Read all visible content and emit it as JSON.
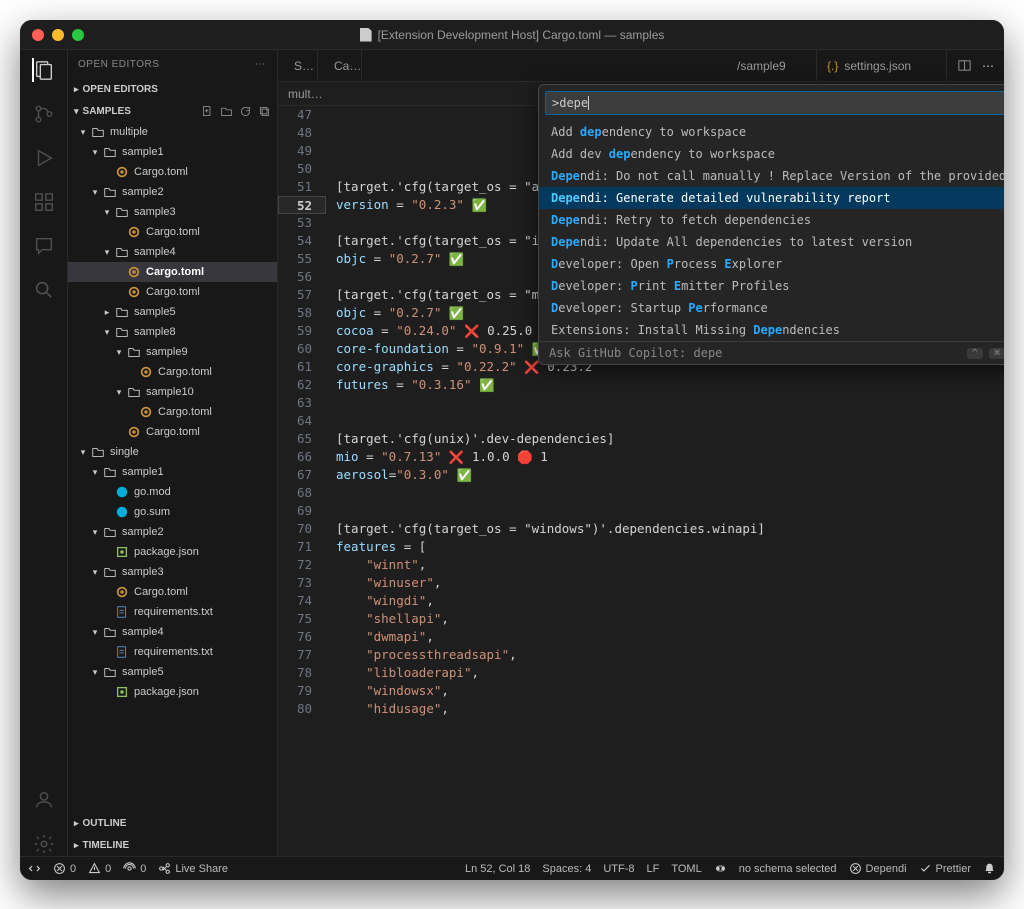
{
  "window": {
    "title": "[Extension Development Host] Cargo.toml — samples"
  },
  "sidebar": {
    "header": "OPEN EDITORS",
    "sections": {
      "openEditors": "OPEN EDITORS",
      "samples": "SAMPLES",
      "outline": "OUTLINE",
      "timeline": "TIMELINE"
    },
    "tree": [
      {
        "depth": 0,
        "type": "folder",
        "open": true,
        "label": "multiple"
      },
      {
        "depth": 1,
        "type": "folder",
        "open": true,
        "label": "sample1"
      },
      {
        "depth": 2,
        "type": "cargo",
        "label": "Cargo.toml"
      },
      {
        "depth": 1,
        "type": "folder",
        "open": true,
        "label": "sample2"
      },
      {
        "depth": 2,
        "type": "folder",
        "open": true,
        "label": "sample3"
      },
      {
        "depth": 3,
        "type": "cargo",
        "label": "Cargo.toml"
      },
      {
        "depth": 2,
        "type": "folder",
        "open": true,
        "label": "sample4"
      },
      {
        "depth": 3,
        "type": "cargo",
        "label": "Cargo.toml",
        "selected": true
      },
      {
        "depth": 3,
        "type": "cargo",
        "label": "Cargo.toml"
      },
      {
        "depth": 2,
        "type": "folder",
        "open": false,
        "label": "sample5"
      },
      {
        "depth": 2,
        "type": "folder",
        "open": true,
        "label": "sample8"
      },
      {
        "depth": 3,
        "type": "folder",
        "open": true,
        "label": "sample9"
      },
      {
        "depth": 4,
        "type": "cargo",
        "label": "Cargo.toml"
      },
      {
        "depth": 3,
        "type": "folder",
        "open": true,
        "label": "sample10"
      },
      {
        "depth": 4,
        "type": "cargo",
        "label": "Cargo.toml"
      },
      {
        "depth": 3,
        "type": "cargo",
        "label": "Cargo.toml"
      },
      {
        "depth": 0,
        "type": "folder",
        "open": true,
        "label": "single"
      },
      {
        "depth": 1,
        "type": "folder",
        "open": true,
        "label": "sample1"
      },
      {
        "depth": 2,
        "type": "go",
        "label": "go.mod"
      },
      {
        "depth": 2,
        "type": "go",
        "label": "go.sum"
      },
      {
        "depth": 1,
        "type": "folder",
        "open": true,
        "label": "sample2"
      },
      {
        "depth": 2,
        "type": "npm",
        "label": "package.json"
      },
      {
        "depth": 1,
        "type": "folder",
        "open": true,
        "label": "sample3"
      },
      {
        "depth": 2,
        "type": "cargo",
        "label": "Cargo.toml"
      },
      {
        "depth": 2,
        "type": "py",
        "label": "requirements.txt"
      },
      {
        "depth": 1,
        "type": "folder",
        "open": true,
        "label": "sample4"
      },
      {
        "depth": 2,
        "type": "py",
        "label": "requirements.txt"
      },
      {
        "depth": 1,
        "type": "folder",
        "open": true,
        "label": "sample5"
      },
      {
        "depth": 2,
        "type": "npm",
        "label": "package.json"
      }
    ]
  },
  "tabs": {
    "left_trunc": "S…",
    "left2_trunc": "Ca…",
    "right1": "/sample9",
    "right2": "settings.json"
  },
  "breadcrumb": {
    "text": "mult…"
  },
  "palette": {
    "input": ">depe",
    "items": [
      {
        "pre": "Add ",
        "hl": "dep",
        "post": "endency to workspace"
      },
      {
        "pre": "Add dev ",
        "hl": "dep",
        "post": "endency to workspace"
      },
      {
        "pre": "",
        "hl": "Depe",
        "post": "ndi: Do not call manually ! Replace Version of the provided dependen…"
      },
      {
        "pre": "",
        "hl": "Depe",
        "post": "ndi: Generate detailed vulnerability report",
        "selected": true,
        "gear": true
      },
      {
        "pre": "",
        "hl": "Depe",
        "post": "ndi: Retry to fetch dependencies"
      },
      {
        "pre": "",
        "hl": "Depe",
        "post": "ndi: Update All dependencies to latest version"
      },
      {
        "pre": "",
        "hl": "D",
        "post": "eveloper: Open ",
        "hl2": "P",
        "post2": "rocess ",
        "hl3": "E",
        "post3": "xplorer"
      },
      {
        "pre": "",
        "hl": "D",
        "post": "eveloper: ",
        "hl2": "P",
        "post2": "rint ",
        "hl3": "E",
        "post3": "mitter Profiles"
      },
      {
        "pre": "",
        "hl": "D",
        "post": "eveloper: Startup ",
        "hl2": "Pe",
        "post2": "rformance"
      },
      {
        "pre": "Extensions: Install Missing ",
        "hl": "Depe",
        "post": "ndencies"
      }
    ],
    "footer": "Ask GitHub Copilot: depe"
  },
  "code": {
    "lines": [
      {
        "n": 47,
        "t": ""
      },
      {
        "n": 48,
        "t": ""
      },
      {
        "n": 49,
        "t": ""
      },
      {
        "n": 50,
        "t": ""
      },
      {
        "n": 51,
        "parts": [
          {
            "c": "sec",
            "t": "[target.'cfg(target_os = \"android\")'.dependencies.android_glue]"
          }
        ]
      },
      {
        "n": 52,
        "current": true,
        "parts": [
          {
            "c": "key",
            "t": "version"
          },
          {
            "c": "op",
            "t": " = "
          },
          {
            "c": "str",
            "t": "\"0.2.3\""
          },
          {
            "c": "op",
            "t": " "
          },
          {
            "emoji": "check"
          }
        ]
      },
      {
        "n": 53,
        "t": ""
      },
      {
        "n": 54,
        "parts": [
          {
            "c": "sec",
            "t": "[target.'cfg(target_os = \"ios\")'.dependencies]"
          }
        ]
      },
      {
        "n": 55,
        "parts": [
          {
            "c": "key",
            "t": "objc"
          },
          {
            "c": "op",
            "t": " = "
          },
          {
            "c": "str",
            "t": "\"0.2.7\""
          },
          {
            "c": "op",
            "t": " "
          },
          {
            "emoji": "check"
          }
        ]
      },
      {
        "n": 56,
        "t": ""
      },
      {
        "n": 57,
        "parts": [
          {
            "c": "sec",
            "t": "[target.'cfg(target_os = \"macos\")'.dependencies]"
          }
        ]
      },
      {
        "n": 58,
        "parts": [
          {
            "c": "key",
            "t": "objc"
          },
          {
            "c": "op",
            "t": " = "
          },
          {
            "c": "str",
            "t": "\"0.2.7\""
          },
          {
            "c": "op",
            "t": " "
          },
          {
            "emoji": "check"
          }
        ]
      },
      {
        "n": 59,
        "parts": [
          {
            "c": "key",
            "t": "cocoa"
          },
          {
            "c": "op",
            "t": " = "
          },
          {
            "c": "str",
            "t": "\"0.24.0\""
          },
          {
            "c": "op",
            "t": " "
          },
          {
            "emoji": "cross"
          },
          {
            "c": "op",
            "t": " 0.25.0"
          }
        ]
      },
      {
        "n": 60,
        "parts": [
          {
            "c": "key",
            "t": "core-foundation"
          },
          {
            "c": "op",
            "t": " = "
          },
          {
            "c": "str",
            "t": "\"0.9.1\""
          },
          {
            "c": "op",
            "t": " "
          },
          {
            "emoji": "check"
          }
        ]
      },
      {
        "n": 61,
        "parts": [
          {
            "c": "key",
            "t": "core-graphics"
          },
          {
            "c": "op",
            "t": " = "
          },
          {
            "c": "str",
            "t": "\"0.22.2\""
          },
          {
            "c": "op",
            "t": " "
          },
          {
            "emoji": "cross"
          },
          {
            "c": "op",
            "t": " 0.23.2"
          }
        ]
      },
      {
        "n": 62,
        "parts": [
          {
            "c": "key",
            "t": "futures"
          },
          {
            "c": "op",
            "t": " = "
          },
          {
            "c": "str",
            "t": "\"0.3.16\""
          },
          {
            "c": "op",
            "t": " "
          },
          {
            "emoji": "check"
          }
        ]
      },
      {
        "n": 63,
        "t": ""
      },
      {
        "n": 64,
        "t": ""
      },
      {
        "n": 65,
        "parts": [
          {
            "c": "sec",
            "t": "[target.'cfg(unix)'.dev-dependencies]"
          }
        ]
      },
      {
        "n": 66,
        "parts": [
          {
            "c": "key",
            "t": "mio"
          },
          {
            "c": "op",
            "t": " = "
          },
          {
            "c": "str",
            "t": "\"0.7.13\""
          },
          {
            "c": "op",
            "t": " "
          },
          {
            "emoji": "cross"
          },
          {
            "c": "op",
            "t": " 1.0.0 "
          },
          {
            "emoji": "stop"
          },
          {
            "c": "op",
            "t": " 1"
          }
        ]
      },
      {
        "n": 67,
        "parts": [
          {
            "c": "key",
            "t": "aerosol"
          },
          {
            "c": "op",
            "t": "="
          },
          {
            "c": "str",
            "t": "\"0.3.0\""
          },
          {
            "c": "op",
            "t": " "
          },
          {
            "emoji": "check"
          }
        ]
      },
      {
        "n": 68,
        "t": ""
      },
      {
        "n": 69,
        "t": ""
      },
      {
        "n": 70,
        "parts": [
          {
            "c": "sec",
            "t": "[target.'cfg(target_os = \"windows\")'.dependencies.winapi]"
          }
        ]
      },
      {
        "n": 71,
        "parts": [
          {
            "c": "key",
            "t": "features"
          },
          {
            "c": "op",
            "t": " = ["
          }
        ]
      },
      {
        "n": 72,
        "parts": [
          {
            "c": "op",
            "t": "    "
          },
          {
            "c": "str",
            "t": "\"winnt\""
          },
          {
            "c": "op",
            "t": ","
          }
        ]
      },
      {
        "n": 73,
        "parts": [
          {
            "c": "op",
            "t": "    "
          },
          {
            "c": "str",
            "t": "\"winuser\""
          },
          {
            "c": "op",
            "t": ","
          }
        ]
      },
      {
        "n": 74,
        "parts": [
          {
            "c": "op",
            "t": "    "
          },
          {
            "c": "str",
            "t": "\"wingdi\""
          },
          {
            "c": "op",
            "t": ","
          }
        ]
      },
      {
        "n": 75,
        "parts": [
          {
            "c": "op",
            "t": "    "
          },
          {
            "c": "str",
            "t": "\"shellapi\""
          },
          {
            "c": "op",
            "t": ","
          }
        ]
      },
      {
        "n": 76,
        "parts": [
          {
            "c": "op",
            "t": "    "
          },
          {
            "c": "str",
            "t": "\"dwmapi\""
          },
          {
            "c": "op",
            "t": ","
          }
        ]
      },
      {
        "n": 77,
        "parts": [
          {
            "c": "op",
            "t": "    "
          },
          {
            "c": "str",
            "t": "\"processthreadsapi\""
          },
          {
            "c": "op",
            "t": ","
          }
        ]
      },
      {
        "n": 78,
        "parts": [
          {
            "c": "op",
            "t": "    "
          },
          {
            "c": "str",
            "t": "\"libloaderapi\""
          },
          {
            "c": "op",
            "t": ","
          }
        ]
      },
      {
        "n": 79,
        "parts": [
          {
            "c": "op",
            "t": "    "
          },
          {
            "c": "str",
            "t": "\"windowsx\""
          },
          {
            "c": "op",
            "t": ","
          }
        ]
      },
      {
        "n": 80,
        "parts": [
          {
            "c": "op",
            "t": "    "
          },
          {
            "c": "str",
            "t": "\"hidusage\""
          },
          {
            "c": "op",
            "t": ","
          }
        ]
      }
    ]
  },
  "status": {
    "errors": "0",
    "warnings": "0",
    "ports": "0",
    "liveShare": "Live Share",
    "lnCol": "Ln 52, Col 18",
    "spaces": "Spaces: 4",
    "encoding": "UTF-8",
    "eol": "LF",
    "lang": "TOML",
    "schema": "no schema selected",
    "dependi": "Dependi",
    "prettier": "Prettier"
  }
}
